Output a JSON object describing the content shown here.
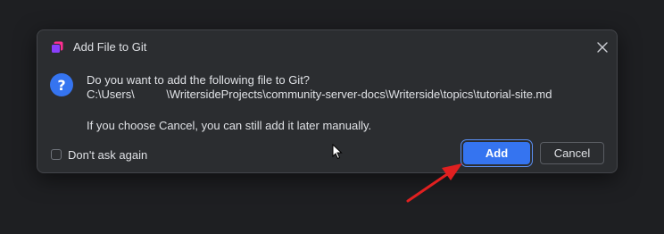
{
  "dialog": {
    "title": "Add File to Git",
    "icon": "git-app-icon",
    "close_icon": "close-icon",
    "question_icon_glyph": "?",
    "message_line1": "Do you want to add the following file to Git?",
    "message_line2": "C:\\Users\\          \\WritersideProjects\\community-server-docs\\Writerside\\topics\\tutorial-site.md",
    "message_line3": "If you choose Cancel, you can still add it later manually.",
    "checkbox_label": "Don't ask again",
    "checkbox_checked": false,
    "add_label": "Add",
    "cancel_label": "Cancel"
  },
  "colors": {
    "background": "#1e1f22",
    "dialog": "#2b2d30",
    "accent": "#3574f0",
    "text": "#dfe1e5",
    "annotation_arrow": "#e02020"
  }
}
